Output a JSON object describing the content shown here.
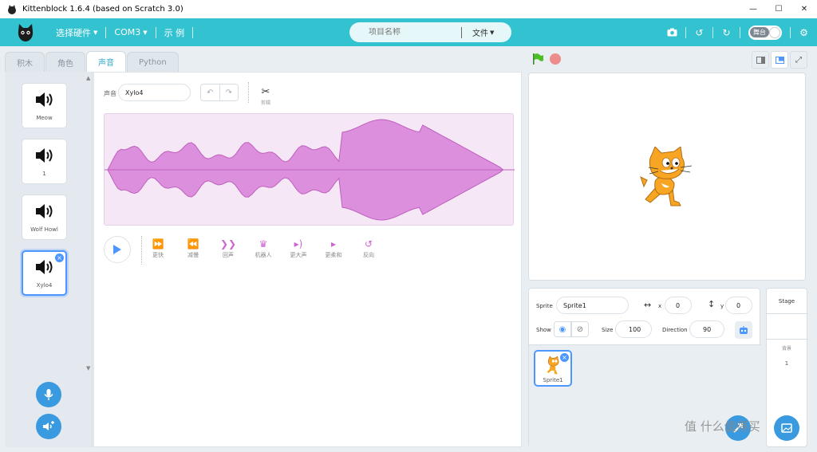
{
  "window": {
    "title": "Kittenblock 1.6.4 (based on Scratch 3.0)",
    "controls": [
      "minimize",
      "maximize",
      "close"
    ]
  },
  "menubar": {
    "hardware_label": "选择硬件",
    "port_label": "COM3",
    "examples_label": "示 例",
    "project_placeholder": "项目名称",
    "file_label": "文件",
    "stage_toggle_label": "舞台"
  },
  "tabs": [
    {
      "label": "积木"
    },
    {
      "label": "角色"
    },
    {
      "label": "声音",
      "active": true
    },
    {
      "label": "Python"
    }
  ],
  "sounds": [
    {
      "name": "Meow"
    },
    {
      "name": "1"
    },
    {
      "name": "Wolf Howl"
    },
    {
      "name": "Xylo4",
      "selected": true
    }
  ],
  "editor": {
    "sound_label": "声音",
    "sound_name": "Xylo4",
    "trim_label": "剪辑",
    "effects": [
      {
        "label": "更快",
        "icon": "faster-icon"
      },
      {
        "label": "减慢",
        "icon": "slower-icon"
      },
      {
        "label": "回声",
        "icon": "echo-icon"
      },
      {
        "label": "机器人",
        "icon": "robot-icon"
      },
      {
        "label": "更大声",
        "icon": "louder-icon"
      },
      {
        "label": "更柔和",
        "icon": "softer-icon"
      },
      {
        "label": "反向",
        "icon": "reverse-icon"
      }
    ],
    "waveform_color": "#dc8fdc"
  },
  "sprite_info": {
    "sprite_label": "Sprite",
    "sprite_name": "Sprite1",
    "x_label": "x",
    "x_value": "0",
    "y_label": "y",
    "y_value": "0",
    "show_label": "Show",
    "size_label": "Size",
    "size_value": "100",
    "direction_label": "Direction",
    "direction_value": "90"
  },
  "sprites": [
    {
      "name": "Sprite1",
      "selected": true
    }
  ],
  "stage_panel": {
    "title": "Stage",
    "backdrops_label": "背景",
    "backdrops_count": "1"
  },
  "watermark": "值 什么值得买",
  "colors": {
    "accent": "#33c2cf",
    "selection": "#4c97ff",
    "effect": "#cf63cf"
  }
}
